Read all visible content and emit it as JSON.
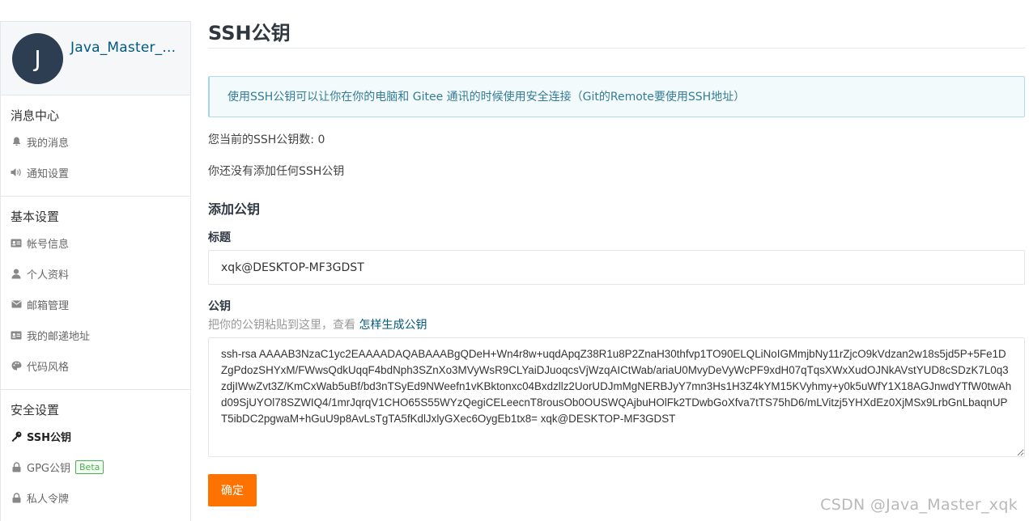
{
  "profile": {
    "avatar_letter": "J",
    "username": "Java_Master_..."
  },
  "sidebar": {
    "sections": [
      {
        "title": "消息中心",
        "items": [
          {
            "label": "我的消息",
            "icon": "bell-icon"
          },
          {
            "label": "通知设置",
            "icon": "speaker-icon"
          }
        ]
      },
      {
        "title": "基本设置",
        "items": [
          {
            "label": "帐号信息",
            "icon": "id-card-icon"
          },
          {
            "label": "个人资料",
            "icon": "user-icon"
          },
          {
            "label": "邮箱管理",
            "icon": "envelope-icon"
          },
          {
            "label": "我的邮递地址",
            "icon": "address-card-icon"
          },
          {
            "label": "代码风格",
            "icon": "palette-icon"
          }
        ]
      },
      {
        "title": "安全设置",
        "items": [
          {
            "label": "SSH公钥",
            "icon": "key-icon",
            "active": true
          },
          {
            "label": "GPG公钥",
            "icon": "lock-icon",
            "badge": "Beta"
          },
          {
            "label": "私人令牌",
            "icon": "token-icon"
          }
        ]
      }
    ]
  },
  "main": {
    "title": "SSH公钥",
    "info": "使用SSH公钥可以让你在你的电脑和 Gitee 通讯的时候使用安全连接（Git的Remote要使用SSH地址）",
    "count_text": "您当前的SSH公钥数: 0",
    "empty_text": "你还没有添加任何SSH公钥",
    "add_heading": "添加公钥",
    "title_label": "标题",
    "title_value": "xqk@DESKTOP-MF3GDST",
    "key_label": "公钥",
    "helper_text": "把你的公钥粘贴到这里，查看 ",
    "helper_link": "怎样生成公钥",
    "key_value": "ssh-rsa AAAAB3NzaC1yc2EAAAADAQABAAABgQDeH+Wn4r8w+uqdApqZ38R1u8P2ZnaH30thfvp1TO90ELQLiNoIGMmjbNy11rZjcO9kVdzan2w18s5jd5P+5Fe1DZgPdozSHYxM/FWwsQdkUqqF4bdNph3SZnXo3MVyWsR9CLYaiDJuoqcsVjWzqAICtWab/ariaU0MvyDeVyWcPF9xdH07qTqsXWxXudOJNkAVstYUD8cSDzK7L0q3zdjIWwZvt3Z/KmCxWab5uBf/bd3nTSyEd9NWeefn1vKBktonxc04Bxdzllz2UorUDJmMgNERBJyY7mn3Hs1H3Z4kYM15KVyhmy+y0k5uWfY1X18AGJnwdYTfW0twAhd09SjUYOl78SZWIQ4/1mrJqrqV1CHO65S55WYzQegiCELeecnT8rousOb0OUSWQAjbuHOlFk2TDwbGoXfva7tTS75hD6/mLVitzj5YHXdEz0XjMSx9LrbGnLbaqnUPT5ibDC2pgwaM+hGuU9p8AvLsTgTA5fKdlJxlyGXec6OygEb1tx8= xqk@DESKTOP-MF3GDST",
    "submit_label": "确定"
  },
  "watermark": "CSDN @Java_Master_xqk",
  "colors": {
    "accent": "#fe7300",
    "link": "#005980",
    "avatar_bg": "#2e3e52",
    "info_bg": "#f2fafc"
  }
}
